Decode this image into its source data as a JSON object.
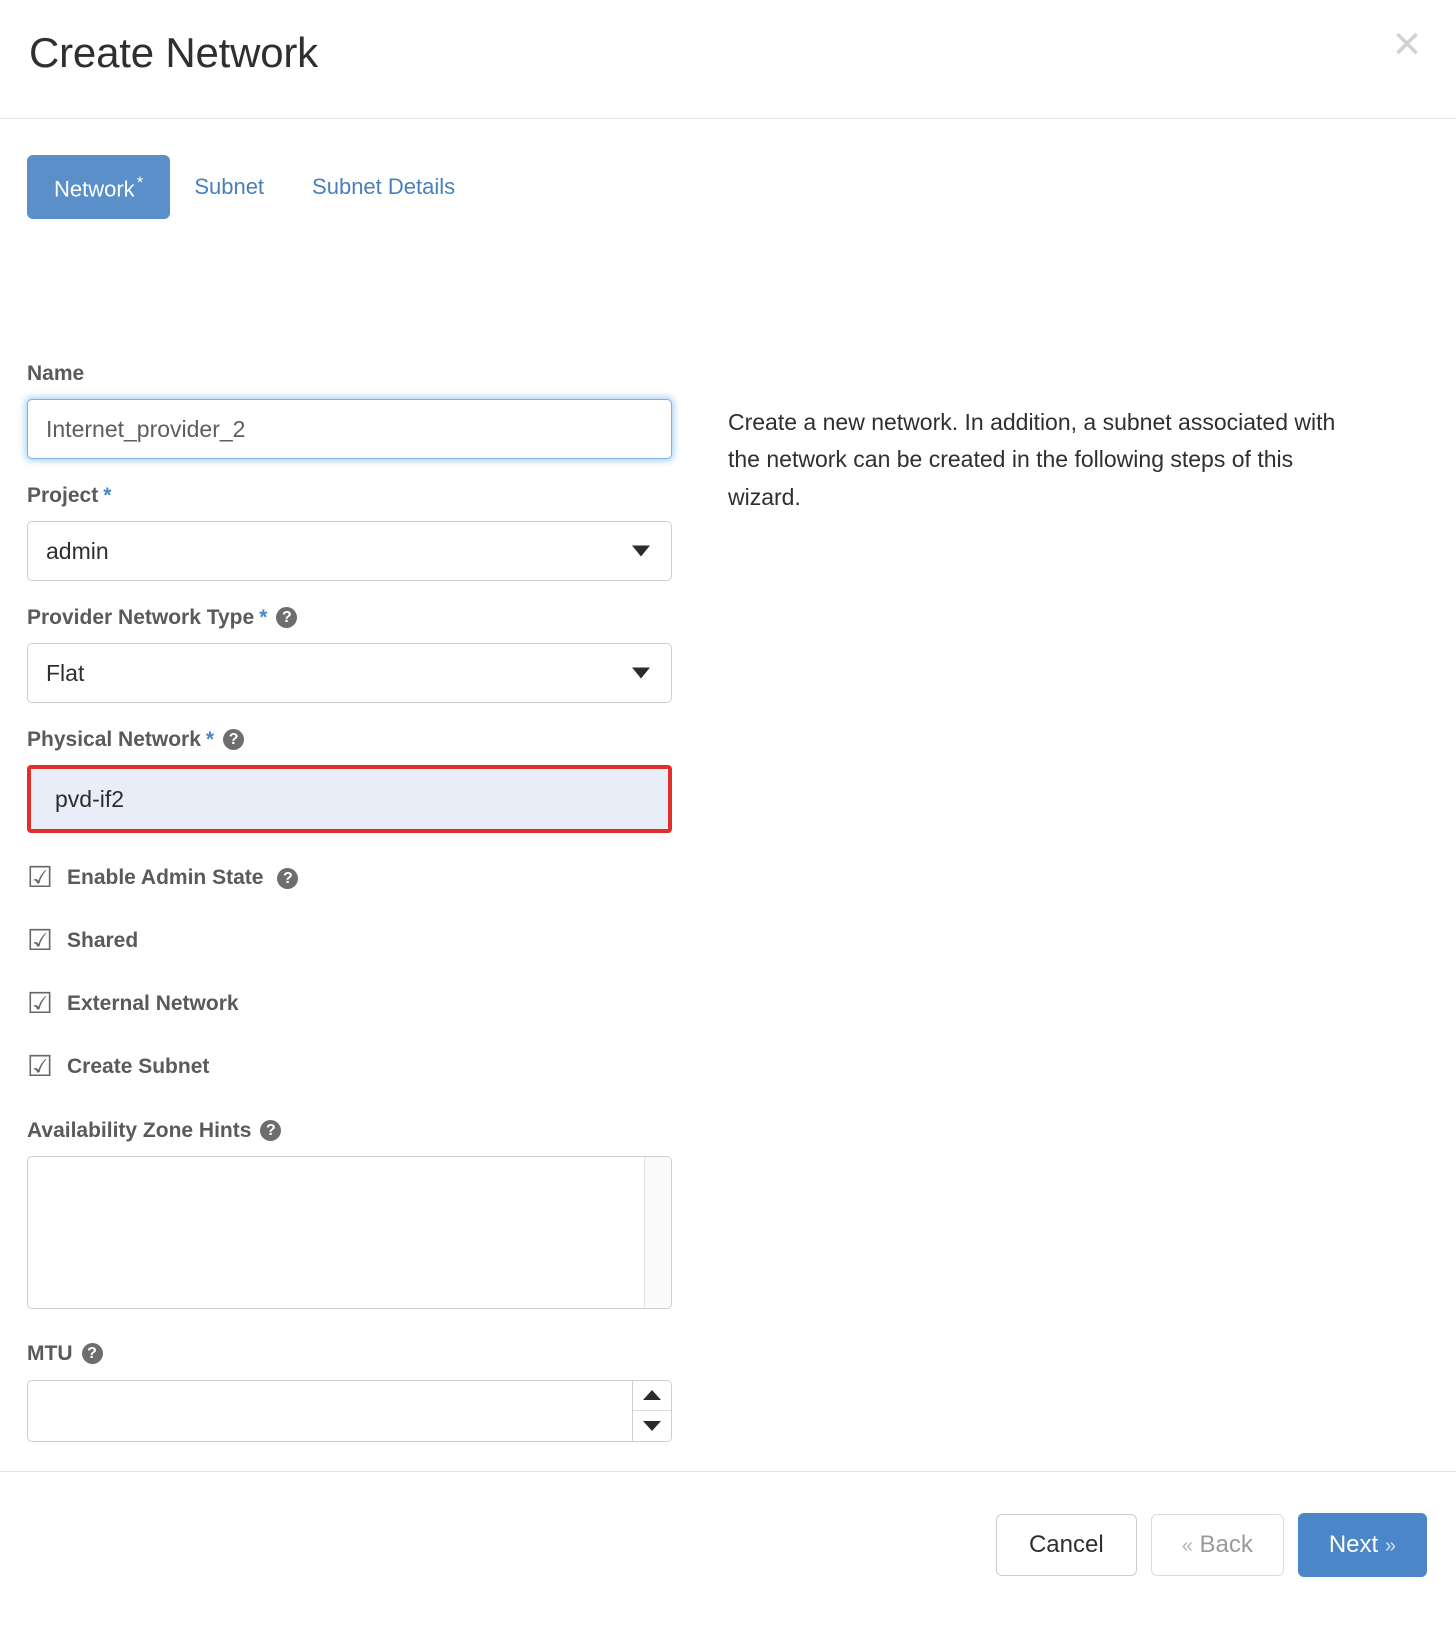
{
  "dialog": {
    "title": "Create Network",
    "close_label": "✕"
  },
  "tabs": [
    {
      "label": "Network",
      "required_marker": "*",
      "active": true
    },
    {
      "label": "Subnet",
      "required_marker": "",
      "active": false
    },
    {
      "label": "Subnet Details",
      "required_marker": "",
      "active": false
    }
  ],
  "description": "Create a new network. In addition, a subnet associated with the network can be created in the following steps of this wizard.",
  "fields": {
    "name": {
      "label": "Name",
      "value": "Internet_provider_2",
      "placeholder": "Internet_provider_2"
    },
    "project": {
      "label": "Project",
      "required_marker": "*",
      "value": "admin"
    },
    "provider_network_type": {
      "label": "Provider Network Type",
      "required_marker": "*",
      "help": "?",
      "value": "Flat"
    },
    "physical_network": {
      "label": "Physical Network",
      "required_marker": "*",
      "help": "?",
      "value": "pvd-if2",
      "highlight_color": "#e0302c",
      "highlight_fill": "#e9edf8"
    },
    "availability_zone_hints": {
      "label": "Availability Zone Hints",
      "help": "?",
      "value": ""
    },
    "mtu": {
      "label": "MTU",
      "help": "?",
      "value": ""
    }
  },
  "checkboxes": [
    {
      "label": "Enable Admin State",
      "checked": true,
      "glyph": "☑",
      "help": "?"
    },
    {
      "label": "Shared",
      "checked": true,
      "glyph": "☑",
      "help": ""
    },
    {
      "label": "External Network",
      "checked": true,
      "glyph": "☑",
      "help": ""
    },
    {
      "label": "Create Subnet",
      "checked": true,
      "glyph": "☑",
      "help": ""
    }
  ],
  "footer": {
    "cancel_label": "Cancel",
    "back_label": "Back",
    "back_chevron": "«",
    "next_label": "Next",
    "next_chevron": "»"
  },
  "colors": {
    "accent": "#4a86c8",
    "tab_active_bg": "#5b8fc9",
    "required_star": "#4a86c8",
    "highlight_border": "#e0302c"
  }
}
